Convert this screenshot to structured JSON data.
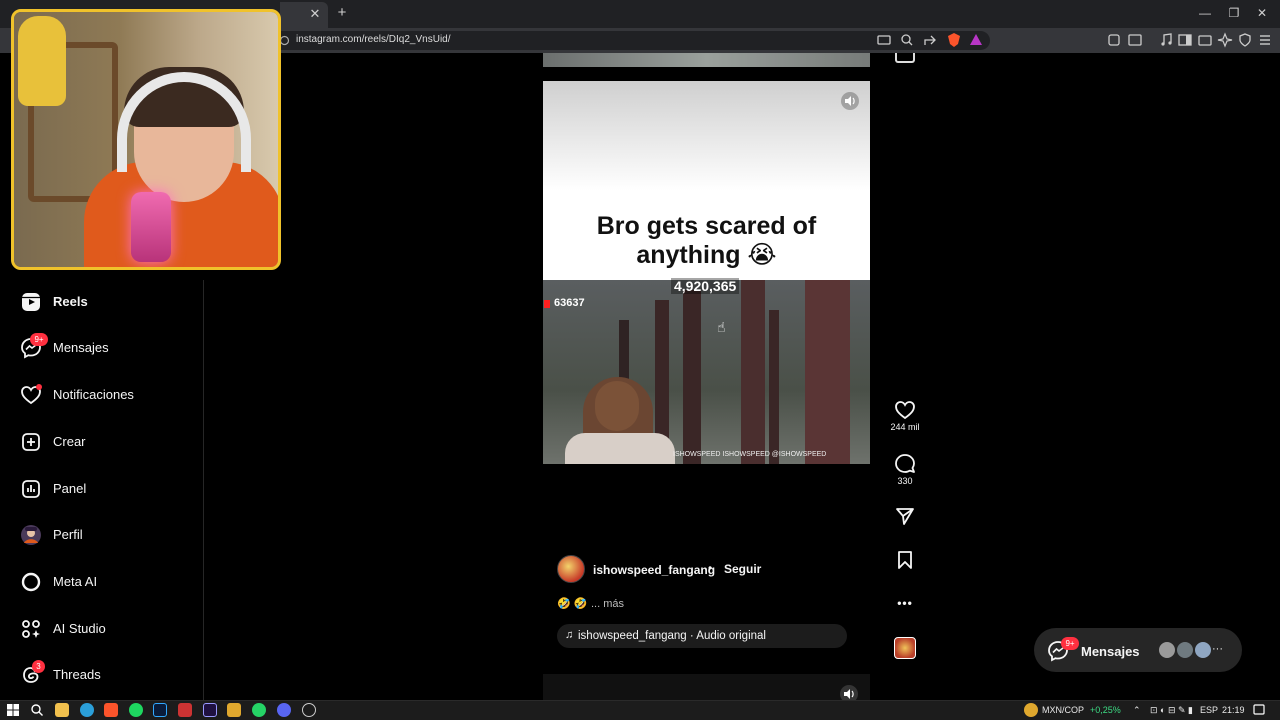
{
  "browser": {
    "url": "instagram.com/reels/DIq2_VnsUid/",
    "tab_close": "✕",
    "new_tab": "+",
    "window_minimize": "—",
    "window_restore": "❐",
    "window_close": "✕"
  },
  "nav": {
    "items": [
      {
        "label": "Reels",
        "icon": "reels-icon",
        "active": true
      },
      {
        "label": "Mensajes",
        "icon": "messenger-icon",
        "badge": "9+"
      },
      {
        "label": "Notificaciones",
        "icon": "heart-icon",
        "dot": true
      },
      {
        "label": "Crear",
        "icon": "plus-square-icon"
      },
      {
        "label": "Panel",
        "icon": "chart-icon"
      },
      {
        "label": "Perfil",
        "icon": "avatar-icon"
      },
      {
        "label": "Meta AI",
        "icon": "meta-ai-icon"
      },
      {
        "label": "AI Studio",
        "icon": "ai-studio-icon"
      },
      {
        "label": "Threads",
        "icon": "threads-icon",
        "badge": "3"
      }
    ]
  },
  "reel": {
    "caption_line1": "Bro gets scared of",
    "caption_line2": "anything 😭",
    "game_count_top": "4,920,365",
    "game_count_left": "63637",
    "game_footer": "ISHOWSPEED  ISHOWSPEED  @ISHOWSPEED",
    "likes": "244 mil",
    "comments": "330",
    "author": "ishowspeed_fangang",
    "separator": "•",
    "follow": "Seguir",
    "description_emoji": "🤣 🤣",
    "description_more": "... más",
    "audio_icon": "♫",
    "audio": "ishowspeed_fangang · Audio original",
    "more_options": "•••"
  },
  "messages": {
    "label": "Mensajes",
    "badge": "9+",
    "more": "···"
  },
  "taskbar": {
    "ticker": "MXN/COP",
    "ticker_change": "+0,25%",
    "language": "ESP",
    "time": "21:19"
  },
  "colors": {
    "accent_badge": "#ff3040",
    "webcam_border": "#f0c22b",
    "ticker_up": "#3ddc84"
  }
}
